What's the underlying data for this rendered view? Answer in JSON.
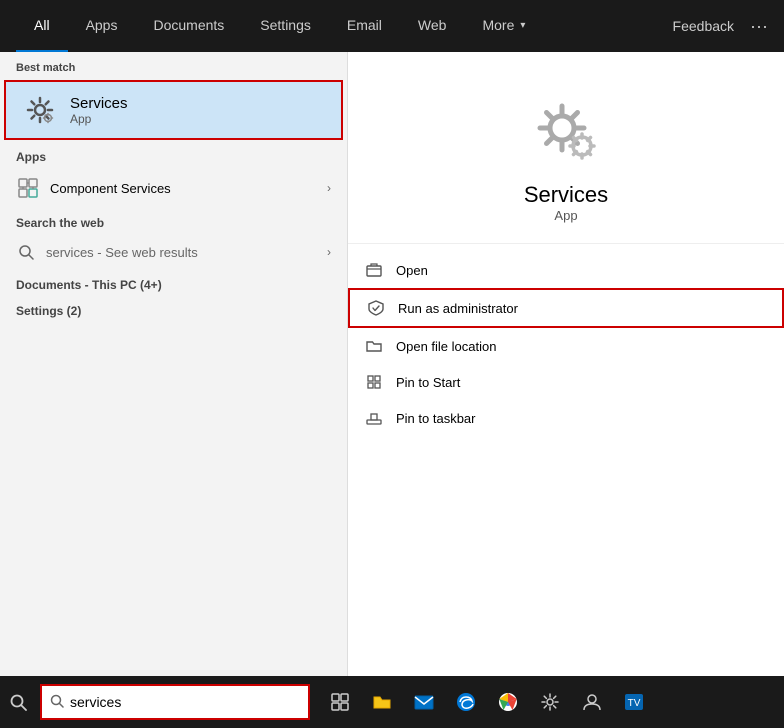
{
  "nav": {
    "tabs": [
      {
        "id": "all",
        "label": "All",
        "active": true
      },
      {
        "id": "apps",
        "label": "Apps"
      },
      {
        "id": "documents",
        "label": "Documents"
      },
      {
        "id": "settings",
        "label": "Settings"
      },
      {
        "id": "email",
        "label": "Email"
      },
      {
        "id": "web",
        "label": "Web"
      },
      {
        "id": "more",
        "label": "More"
      }
    ],
    "feedback": "Feedback",
    "dots": "···"
  },
  "left": {
    "best_match_label": "Best match",
    "best_match": {
      "name": "Services",
      "sub": "App"
    },
    "apps_label": "Apps",
    "apps": [
      {
        "name": "Component Services"
      }
    ],
    "search_web_label": "Search the web",
    "search_web": {
      "query": "services",
      "suffix": " - See web results"
    },
    "documents_label": "Documents - This PC (4+)",
    "settings_label": "Settings (2)"
  },
  "right": {
    "app_name": "Services",
    "app_type": "App",
    "menu": [
      {
        "id": "open",
        "label": "Open",
        "icon": "open-icon"
      },
      {
        "id": "run-admin",
        "label": "Run as administrator",
        "icon": "shield-icon",
        "highlighted": true
      },
      {
        "id": "open-location",
        "label": "Open file location",
        "icon": "folder-icon"
      },
      {
        "id": "pin-start",
        "label": "Pin to Start",
        "icon": "pin-icon"
      },
      {
        "id": "pin-taskbar",
        "label": "Pin to taskbar",
        "icon": "pin-icon2"
      }
    ]
  },
  "taskbar": {
    "search_value": "services",
    "search_placeholder": "services"
  }
}
